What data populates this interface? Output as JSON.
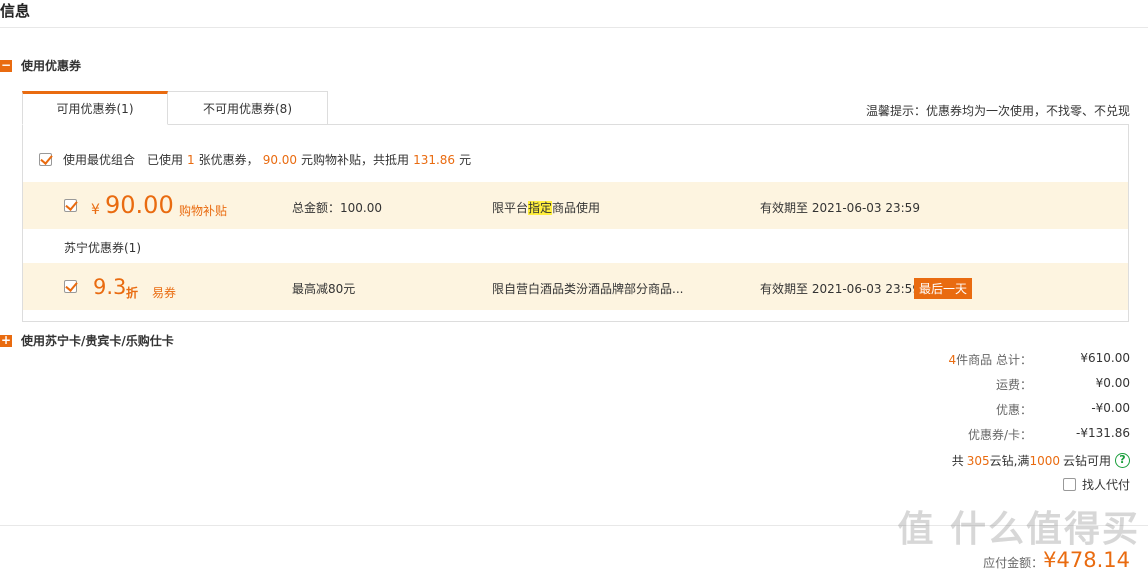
{
  "page": {
    "title": "信息"
  },
  "coupon_section": {
    "icon": "minus",
    "label": "使用优惠券"
  },
  "tabs": [
    {
      "label": "可用优惠券(1)",
      "active": true
    },
    {
      "label": "不可用优惠券(8)",
      "active": false
    }
  ],
  "tip": "温馨提示：优惠券均为一次使用，不找零、不兑现",
  "optimal": {
    "label": "使用最优组合",
    "used_pre": "已使用",
    "used_count": "1",
    "used_mid": "张优惠券，",
    "subsidy_amount": "90.00",
    "subsidy_mid": "元购物补贴，共抵用",
    "total": "131.86",
    "unit": "元",
    "checked": true
  },
  "coupons": [
    {
      "checked": true,
      "currency": "¥",
      "amount": "90.00",
      "type": "购物补贴",
      "condition": "总金额：100.00",
      "scope_pre": "限平台",
      "scope_hl": "指定",
      "scope_post": "商品使用",
      "expiry": "有效期至 2021-06-03 23:59"
    },
    {
      "checked": true,
      "amount": "9.3",
      "unit": "折",
      "type": "易券",
      "condition": "最高减80元",
      "scope": "限自营白酒品类汾酒品牌部分商品...",
      "expiry": "有效期至 2021-06-03 23:59",
      "badge": "最后一天"
    }
  ],
  "suning_group_label": "苏宁优惠券(1)",
  "card_section": {
    "icon": "plus",
    "label": "使用苏宁卡/贵宾卡/乐购仕卡"
  },
  "summary": {
    "goods_count": "4",
    "goods_label": "件商品 总计：",
    "goods_total": "¥610.00",
    "shipping_label": "运费：",
    "shipping": "¥0.00",
    "discount_label": "优惠：",
    "discount": "-¥0.00",
    "coupon_label": "优惠券/卡：",
    "coupon": "-¥131.86",
    "diamond_pre": "共",
    "diamonds": "305",
    "diamond_mid": "云钻,满",
    "diamond_threshold": "1000",
    "diamond_post": "云钻可用",
    "proxy_pay": "找人代付"
  },
  "payable": {
    "label": "应付金额：",
    "amount": "¥478.14"
  },
  "watermark": {
    "text": "值 什么值得买"
  },
  "colors": {
    "accent": "#e96b10",
    "row_bg": "#fdf4e0",
    "highlight": "#ffef3e",
    "help": "#1a9e3c"
  }
}
